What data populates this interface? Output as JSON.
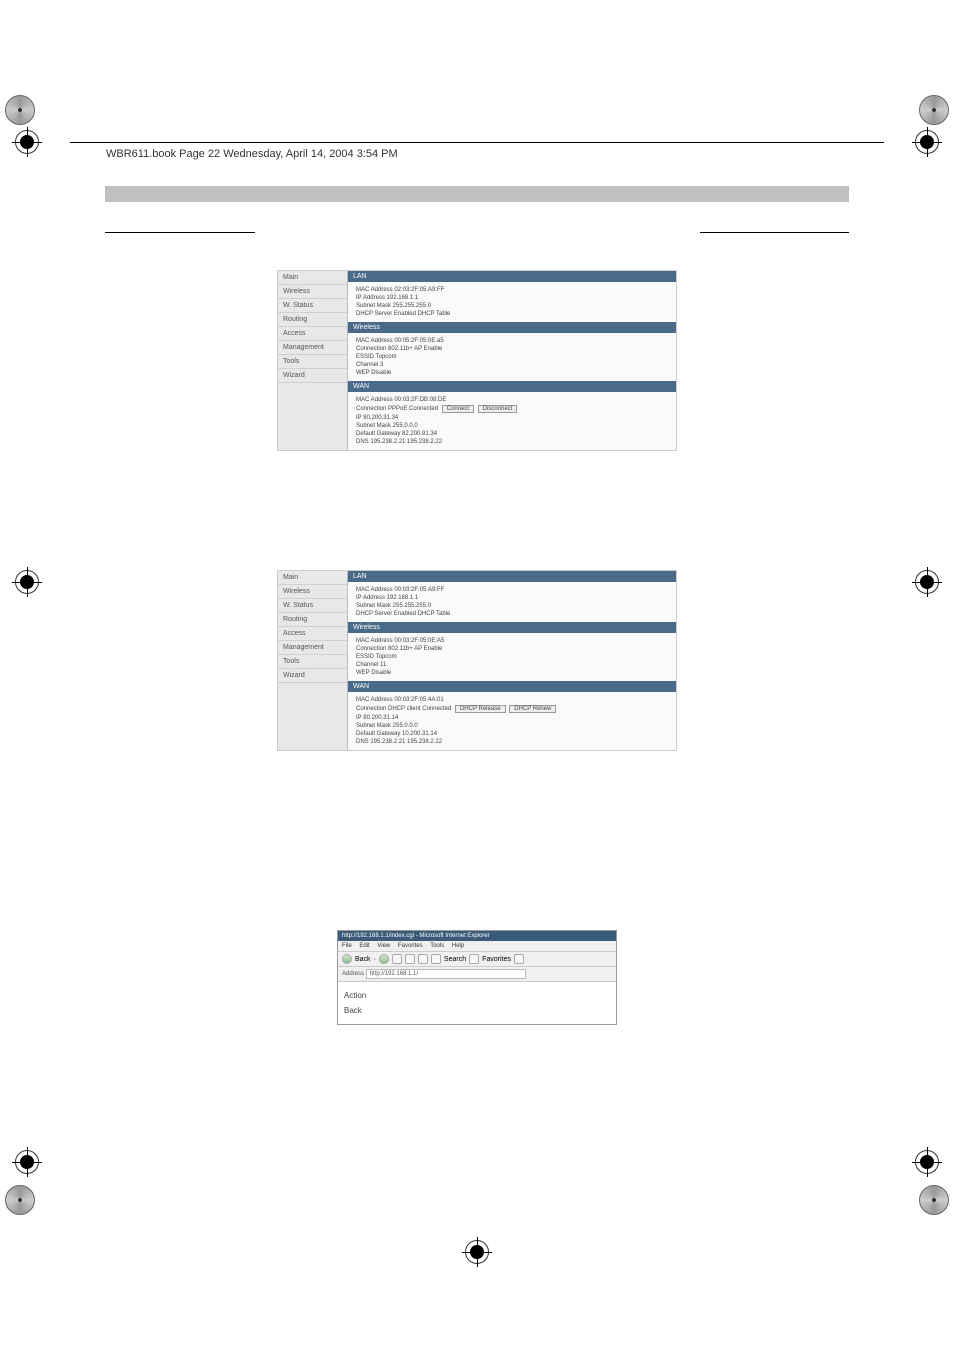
{
  "header": "WBR611.book  Page 22  Wednesday, April 14, 2004  3:54 PM",
  "sidebar_items": [
    "Main",
    "Wireless",
    "W. Status",
    "Routing",
    "Access",
    "Management",
    "Tools",
    "Wizard"
  ],
  "fig1": {
    "lan": {
      "title": "LAN",
      "mac": "MAC Address 02:03:2F:05:A9:FF",
      "ip": "IP Address 192.168.1.1",
      "subnet": "Subnet Mask 255.255.255.0",
      "dhcp": "DHCP Server Enabled  DHCP Table"
    },
    "wireless": {
      "title": "Wireless",
      "mac": "MAC Address 00:05:2F:05:0E:a5",
      "conn": "Connection 802.11b+ AP Enable",
      "essid": "ESSID Topcom",
      "channel": "Channel 3",
      "wep": "WEP Disable"
    },
    "wan": {
      "title": "WAN",
      "mac": "MAC Address 00:03:2F:DB:08:DE",
      "conn": "Connection PPPoE Connected",
      "connect": "Connect",
      "disconnect": "Disconnect",
      "ip": "IP 80.200.31.34",
      "subnet": "Subnet Mask 255.0.0.0",
      "gateway": "Default Gateway 82.200.91.34",
      "dns": "DNS 195.238.2.21 195.238.2.22"
    }
  },
  "fig2": {
    "lan": {
      "title": "LAN",
      "mac": "MAC Address 00:03:2F:05:A9:FF",
      "ip": "IP Address 192.168.1.1",
      "subnet": "Subnet Mask 255.255.255.0",
      "dhcp": "DHCP Server Enabled  DHCP Table"
    },
    "wireless": {
      "title": "Wireless",
      "mac": "MAC Address 00:03:2F:05:0E:A5",
      "conn": "Connection 802.11b+ AP Enable",
      "essid": "ESSID Topcom",
      "channel": "Channel 11",
      "wep": "WEP Disable"
    },
    "wan": {
      "title": "WAN",
      "mac": "MAC Address 00:03:2F:05:4A:01",
      "conn": "Connection DHCP client Connected",
      "release": "DHCP Release",
      "renew": "DHCP Renew",
      "ip": "IP 80.200.31.14",
      "subnet": "Subnet Mask 255.0.0.0",
      "gateway": "Default Gateway 10.200.31.14",
      "dns": "DNS 195.238.2.21 195.238.2.22"
    }
  },
  "fig3": {
    "title": "http://192.168.1.1/index.cgi - Microsoft Internet Explorer",
    "menus": [
      "File",
      "Edit",
      "View",
      "Favorites",
      "Tools",
      "Help"
    ],
    "back": "Back",
    "search": "Search",
    "favorites": "Favorites",
    "addr_label": "Address",
    "addr": "http://192.168.1.1/",
    "body_items": [
      "Action",
      "Back"
    ]
  }
}
